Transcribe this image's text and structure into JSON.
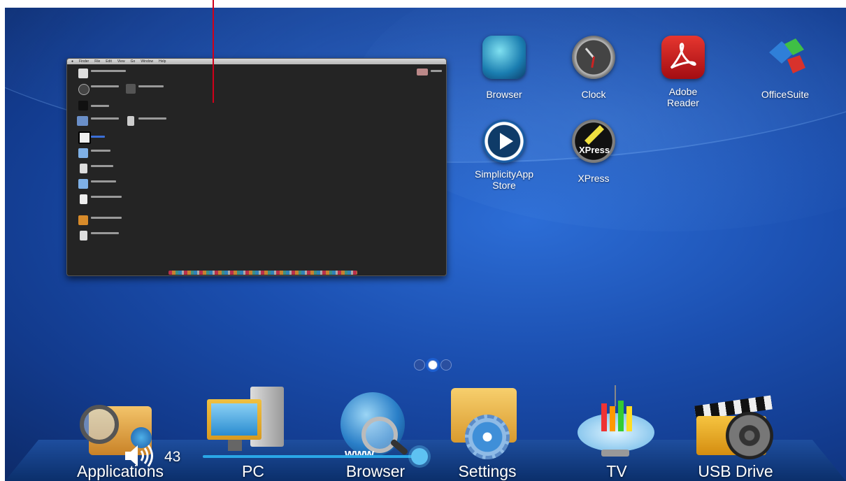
{
  "apps": [
    {
      "id": "browser",
      "label": "Browser",
      "icon": "globe-icon"
    },
    {
      "id": "clock",
      "label": "Clock",
      "icon": "clock-icon"
    },
    {
      "id": "adobe",
      "label": "Adobe\nReader",
      "icon": "adobe-reader-icon"
    },
    {
      "id": "office",
      "label": "OfficeSuite",
      "icon": "office-suite-icon"
    },
    {
      "id": "simplicity",
      "label": "SimplicityApp\nStore",
      "icon": "play-store-icon"
    },
    {
      "id": "xpress",
      "label": "XPress",
      "icon": "xpress-icon"
    }
  ],
  "thumbnail": {
    "menu": [
      "Finder",
      "File",
      "Edit",
      "View",
      "Go",
      "Window",
      "Help"
    ]
  },
  "pager": {
    "count": 3,
    "active": 1
  },
  "dock": [
    {
      "label": "Applications",
      "icon": "applications-icon"
    },
    {
      "label": "PC",
      "icon": "pc-icon"
    },
    {
      "label": "Browser",
      "icon": "globe-search-icon"
    },
    {
      "label": "Settings",
      "icon": "settings-folder-icon"
    },
    {
      "label": "TV",
      "icon": "tv-satellite-icon"
    },
    {
      "label": "USB Drive",
      "icon": "usb-drive-icon"
    }
  ],
  "volume": {
    "value": "43",
    "level": 0.43
  },
  "colors": {
    "accent": "#2aa7e6",
    "marker": "#d0001a"
  }
}
